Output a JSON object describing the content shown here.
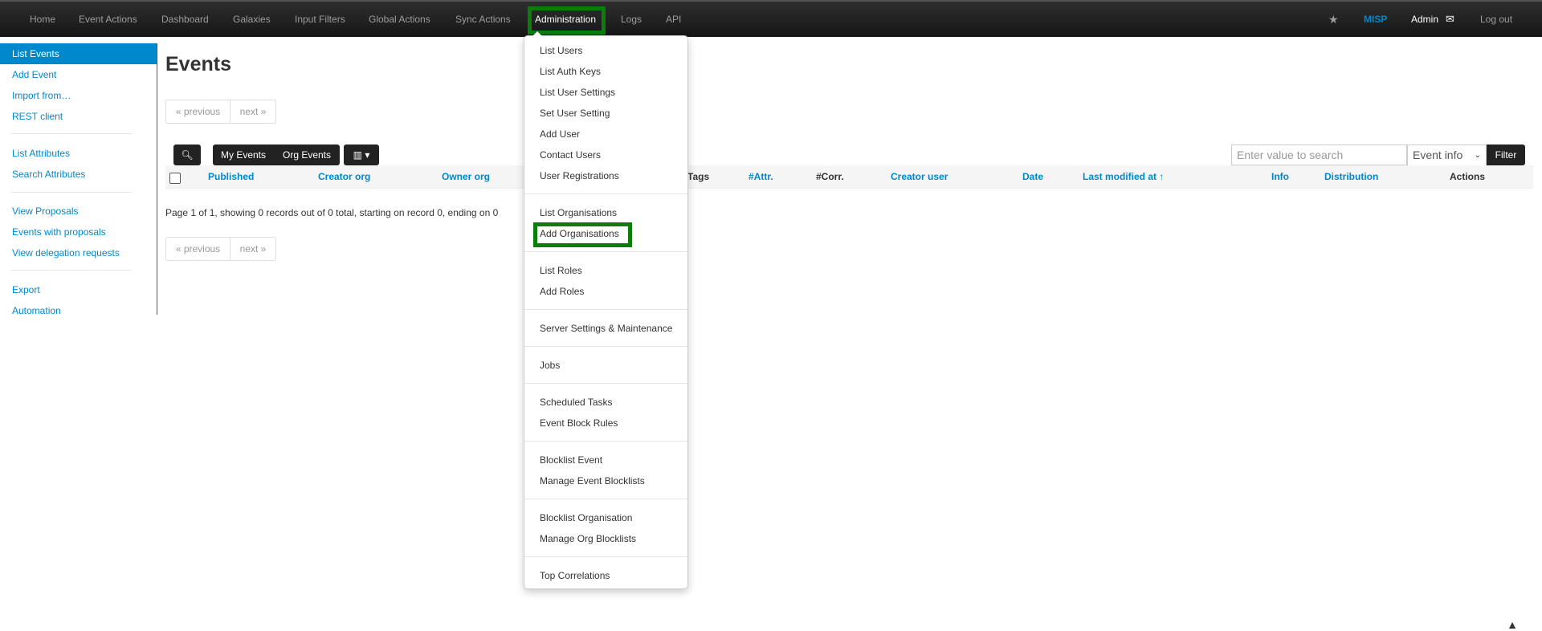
{
  "navbar": {
    "items": [
      "Home",
      "Event Actions",
      "Dashboard",
      "Galaxies",
      "Input Filters",
      "Global Actions",
      "Sync Actions",
      "Administration",
      "Logs",
      "API"
    ],
    "active": "Administration",
    "brand": "MISP",
    "user": "Admin",
    "logout": "Log out",
    "star_icon": "star-icon",
    "mail_icon": "envelope-icon"
  },
  "sidebar": {
    "groups": [
      [
        "List Events",
        "Add Event",
        "Import from…",
        "REST client"
      ],
      [
        "List Attributes",
        "Search Attributes"
      ],
      [
        "View Proposals",
        "Events with proposals",
        "View delegation requests"
      ],
      [
        "Export",
        "Automation"
      ]
    ],
    "active": "List Events"
  },
  "main": {
    "title": "Events",
    "pager": {
      "previous": "« previous",
      "next": "next »"
    },
    "filters": {
      "my_events": "My Events",
      "org_events": "Org Events"
    },
    "search": {
      "placeholder": "Enter value to search",
      "field": "Event info",
      "filter_button": "Filter"
    },
    "columns": [
      "Published",
      "Creator org",
      "Owner org",
      "Tags",
      "#Attr.",
      "#Corr.",
      "Creator user",
      "Date",
      "Last modified at ↑",
      "Info",
      "Distribution",
      "Actions"
    ],
    "paging_info": "Page 1 of 1, showing 0 records out of 0 total, starting on record 0, ending on 0"
  },
  "admin_menu": {
    "groups": [
      [
        "List Users",
        "List Auth Keys",
        "List User Settings",
        "Set User Setting",
        "Add User",
        "Contact Users",
        "User Registrations"
      ],
      [
        "List Organisations",
        "Add Organisations"
      ],
      [
        "List Roles",
        "Add Roles"
      ],
      [
        "Server Settings & Maintenance"
      ],
      [
        "Jobs"
      ],
      [
        "Scheduled Tasks",
        "Event Block Rules"
      ],
      [
        "Blocklist Event",
        "Manage Event Blocklists"
      ],
      [
        "Blocklist Organisation",
        "Manage Org Blocklists"
      ],
      [
        "Top Correlations"
      ]
    ],
    "highlighted": "Add Organisations"
  },
  "colors": {
    "accent": "#0088cc",
    "highlight_box": "#0a7d0a",
    "navbar_bg": "#1b1b1b"
  }
}
